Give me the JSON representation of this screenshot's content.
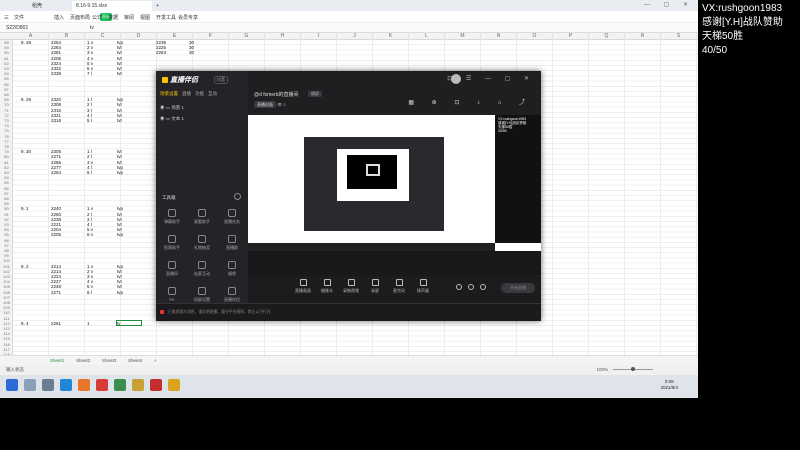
{
  "wps": {
    "tabs": {
      "home": "稻壳",
      "file": "8.16-9.15.xlsx",
      "add": "+"
    },
    "menu": [
      "三",
      "文件",
      "开始",
      "插入",
      "页面布局",
      "公式",
      "数据",
      "审阅",
      "视图",
      "开发工具",
      "会员专享"
    ],
    "start_label": "开始",
    "namebox": "S22/D801",
    "formula": "tv",
    "columns": [
      "A",
      "B",
      "C",
      "D",
      "E",
      "F",
      "G",
      "H",
      "I",
      "J",
      "K",
      "L",
      "M",
      "N",
      "O",
      "P",
      "Q",
      "R",
      "S",
      "T",
      "U",
      "V",
      "W",
      "X",
      "Y",
      "Z"
    ],
    "rows": [
      "58",
      "59",
      "60",
      "61",
      "62",
      "63",
      "64",
      "65",
      "66",
      "67",
      "68",
      "69",
      "70",
      "71",
      "72",
      "73",
      "74",
      "75",
      "76",
      "77",
      "78",
      "79",
      "80",
      "81",
      "82",
      "83",
      "84",
      "85",
      "86",
      "87",
      "88",
      "89",
      "90",
      "91",
      "92",
      "93",
      "94",
      "95",
      "96",
      "97",
      "98",
      "99",
      "100",
      "101",
      "102",
      "103",
      "104",
      "105",
      "106",
      "107",
      "108",
      "109",
      "110",
      "111",
      "112",
      "113",
      "114",
      "115",
      "116",
      "117",
      "118",
      "119",
      "120"
    ],
    "cells": [
      {
        "r": 0,
        "c": 0,
        "v": "9. 28"
      },
      {
        "r": 0,
        "c": 1,
        "v": "2254"
      },
      {
        "r": 0,
        "c": 2,
        "v": "1 v"
      },
      {
        "r": 0,
        "c": 3,
        "v": "tvp"
      },
      {
        "r": 0,
        "c": 4,
        "v": "2235"
      },
      {
        "r": 0,
        "c": 5,
        "v": "30"
      },
      {
        "r": 1,
        "c": 1,
        "v": "2264"
      },
      {
        "r": 1,
        "c": 2,
        "v": "2 v"
      },
      {
        "r": 1,
        "c": 3,
        "v": "tvt"
      },
      {
        "r": 1,
        "c": 4,
        "v": "2225"
      },
      {
        "r": 1,
        "c": 5,
        "v": "30"
      },
      {
        "r": 2,
        "c": 1,
        "v": "2281"
      },
      {
        "r": 2,
        "c": 2,
        "v": "3 v"
      },
      {
        "r": 2,
        "c": 3,
        "v": "tvt"
      },
      {
        "r": 2,
        "c": 4,
        "v": "2263"
      },
      {
        "r": 2,
        "c": 5,
        "v": "30"
      },
      {
        "r": 3,
        "c": 1,
        "v": "2206"
      },
      {
        "r": 3,
        "c": 2,
        "v": "4 v"
      },
      {
        "r": 3,
        "c": 3,
        "v": "tvt"
      },
      {
        "r": 4,
        "c": 1,
        "v": "2324"
      },
      {
        "r": 4,
        "c": 2,
        "v": "5 v"
      },
      {
        "r": 4,
        "c": 3,
        "v": "tvt"
      },
      {
        "r": 5,
        "c": 1,
        "v": "2332"
      },
      {
        "r": 5,
        "c": 2,
        "v": "6 v"
      },
      {
        "r": 5,
        "c": 3,
        "v": "tvt"
      },
      {
        "r": 6,
        "c": 1,
        "v": "2339"
      },
      {
        "r": 6,
        "c": 2,
        "v": "7 l"
      },
      {
        "r": 6,
        "c": 3,
        "v": "tvt"
      },
      {
        "r": 11,
        "c": 0,
        "v": "9. 29"
      },
      {
        "r": 11,
        "c": 1,
        "v": "2320"
      },
      {
        "r": 11,
        "c": 2,
        "v": "1 l"
      },
      {
        "r": 11,
        "c": 3,
        "v": "tvp"
      },
      {
        "r": 12,
        "c": 1,
        "v": "2308"
      },
      {
        "r": 12,
        "c": 2,
        "v": "2 l"
      },
      {
        "r": 12,
        "c": 3,
        "v": "tvt"
      },
      {
        "r": 13,
        "c": 1,
        "v": "2316"
      },
      {
        "r": 13,
        "c": 2,
        "v": "3 l"
      },
      {
        "r": 13,
        "c": 3,
        "v": "tvt"
      },
      {
        "r": 14,
        "c": 1,
        "v": "2321"
      },
      {
        "r": 14,
        "c": 2,
        "v": "4 l"
      },
      {
        "r": 14,
        "c": 3,
        "v": "tvt"
      },
      {
        "r": 15,
        "c": 1,
        "v": "2318"
      },
      {
        "r": 15,
        "c": 2,
        "v": "5 l"
      },
      {
        "r": 15,
        "c": 3,
        "v": "tvt"
      },
      {
        "r": 21,
        "c": 0,
        "v": "9. 30"
      },
      {
        "r": 21,
        "c": 1,
        "v": "2305"
      },
      {
        "r": 21,
        "c": 2,
        "v": "1 l"
      },
      {
        "r": 21,
        "c": 3,
        "v": "tvt"
      },
      {
        "r": 22,
        "c": 1,
        "v": "2271"
      },
      {
        "r": 22,
        "c": 2,
        "v": "2 l"
      },
      {
        "r": 22,
        "c": 3,
        "v": "tvt"
      },
      {
        "r": 23,
        "c": 1,
        "v": "2266"
      },
      {
        "r": 23,
        "c": 2,
        "v": "3 v"
      },
      {
        "r": 23,
        "c": 3,
        "v": "tvt"
      },
      {
        "r": 24,
        "c": 1,
        "v": "2277"
      },
      {
        "r": 24,
        "c": 2,
        "v": "4 l"
      },
      {
        "r": 24,
        "c": 3,
        "v": "tvp"
      },
      {
        "r": 25,
        "c": 1,
        "v": "2254"
      },
      {
        "r": 25,
        "c": 2,
        "v": "5 l"
      },
      {
        "r": 25,
        "c": 3,
        "v": "tvp"
      },
      {
        "r": 32,
        "c": 0,
        "v": "9. 1"
      },
      {
        "r": 32,
        "c": 1,
        "v": "2240"
      },
      {
        "r": 32,
        "c": 2,
        "v": "1 v"
      },
      {
        "r": 32,
        "c": 3,
        "v": "tvp"
      },
      {
        "r": 33,
        "c": 1,
        "v": "2260"
      },
      {
        "r": 33,
        "c": 2,
        "v": "2 l"
      },
      {
        "r": 33,
        "c": 3,
        "v": "tvt"
      },
      {
        "r": 34,
        "c": 1,
        "v": "2238"
      },
      {
        "r": 34,
        "c": 2,
        "v": "3 l"
      },
      {
        "r": 34,
        "c": 3,
        "v": "tvt"
      },
      {
        "r": 34,
        "c": 4,
        "v": "????"
      },
      {
        "r": 35,
        "c": 1,
        "v": "2221"
      },
      {
        "r": 35,
        "c": 2,
        "v": "4 l"
      },
      {
        "r": 35,
        "c": 3,
        "v": "tvt"
      },
      {
        "r": 35,
        "c": 4,
        "v": "????"
      },
      {
        "r": 36,
        "c": 1,
        "v": "2204"
      },
      {
        "r": 36,
        "c": 2,
        "v": "5 v"
      },
      {
        "r": 36,
        "c": 3,
        "v": "tvt"
      },
      {
        "r": 36,
        "c": 4,
        "v": "????"
      },
      {
        "r": 37,
        "c": 1,
        "v": "2205"
      },
      {
        "r": 37,
        "c": 2,
        "v": "6 v"
      },
      {
        "r": 37,
        "c": 3,
        "v": "tvp"
      },
      {
        "r": 43,
        "c": 0,
        "v": "9. 2"
      },
      {
        "r": 43,
        "c": 1,
        "v": "2214"
      },
      {
        "r": 43,
        "c": 2,
        "v": "1 v"
      },
      {
        "r": 43,
        "c": 3,
        "v": "tvp"
      },
      {
        "r": 44,
        "c": 1,
        "v": "2214"
      },
      {
        "r": 44,
        "c": 2,
        "v": "2 v"
      },
      {
        "r": 44,
        "c": 3,
        "v": "tvt"
      },
      {
        "r": 45,
        "c": 1,
        "v": "2224"
      },
      {
        "r": 45,
        "c": 2,
        "v": "3 v"
      },
      {
        "r": 45,
        "c": 3,
        "v": "tvt"
      },
      {
        "r": 46,
        "c": 1,
        "v": "2227"
      },
      {
        "r": 46,
        "c": 2,
        "v": "4 v"
      },
      {
        "r": 46,
        "c": 3,
        "v": "tvt"
      },
      {
        "r": 47,
        "c": 1,
        "v": "2248"
      },
      {
        "r": 47,
        "c": 2,
        "v": "5 v"
      },
      {
        "r": 47,
        "c": 3,
        "v": "tvt"
      },
      {
        "r": 48,
        "c": 1,
        "v": "2271"
      },
      {
        "r": 48,
        "c": 2,
        "v": "6 l"
      },
      {
        "r": 48,
        "c": 3,
        "v": "tvp"
      },
      {
        "r": 54,
        "c": 0,
        "v": "9. 4"
      },
      {
        "r": 54,
        "c": 1,
        "v": "2261"
      },
      {
        "r": 54,
        "c": 2,
        "v": "1"
      },
      {
        "r": 54,
        "c": 3,
        "v": "tv"
      }
    ],
    "sheets": [
      "Sheet1",
      "Sheet2",
      "Sheet3",
      "Sheet4",
      "+"
    ],
    "status_left": "输入状态",
    "zoom": "100%",
    "clock_time": "0:08",
    "clock_date": "2021/9/4"
  },
  "app": {
    "logo": "直播伴侣",
    "badge": "抖音",
    "tabs": [
      "场景设置",
      "直播",
      "功能",
      "互动"
    ],
    "scenes": [
      "场景 1",
      "文本 1"
    ],
    "tools_title": "工具箱",
    "tools": [
      "弹幕助手",
      "观看助手",
      "直播任务",
      "投票助手",
      "礼物抽奖",
      "直播群",
      "直播间",
      "连麦互动",
      "福袋",
      "PK",
      "投屏设置",
      "直播伴侣"
    ],
    "window_title": "@d fsmerb的直播间",
    "window_title_tag": "横屏",
    "sub_label": "直播封面",
    "sub_count": "3",
    "preview_overlay": "VX:rushgoon1983\n感谢[Y.H]战队赞助\n天梯50胜\n40/50",
    "controls": [
      "直播画面",
      "摄像头",
      "录制视频",
      "录屏",
      "麦克风",
      "扬声器"
    ],
    "go_live": "开始直播",
    "footer_notice": "已收到观众消息，请文明直播，遵守平台规则，禁止以下行为"
  },
  "stream_overlay": {
    "line1": "VX:rushgoon1983",
    "line2": "感谢[Y.H]战队赞助",
    "line3": "天梯50胜",
    "line4": "40/50"
  },
  "colors": {
    "accent": "#1bbf5a",
    "app_accent": "#f7c600",
    "app_bg": "#1f1f22"
  }
}
